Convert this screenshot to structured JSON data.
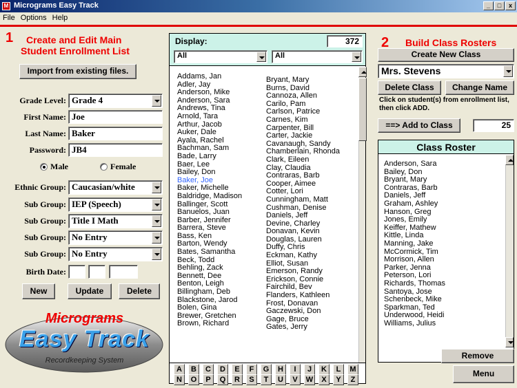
{
  "window": {
    "title": "Micrograms Easy Track",
    "icon": "app-icon",
    "controls": [
      "_",
      "□",
      "x"
    ]
  },
  "menu": [
    "File",
    "Options",
    "Help"
  ],
  "left": {
    "num": "1",
    "heading1": "Create and Edit Main",
    "heading2": "Student Enrollment List",
    "import_button": "Import from existing files.",
    "grade_label": "Grade Level:",
    "grade_value": "Grade 4",
    "first_label": "First Name:",
    "first_value": "Joe",
    "last_label": "Last Name:",
    "last_value": "Baker",
    "password_label": "Password:",
    "password_value": "JB4",
    "male_label": "Male",
    "female_label": "Female",
    "gender_selected": "Male",
    "ethnic_label": "Ethnic Group:",
    "ethnic_value": "Caucasian/white",
    "sub_label": "Sub Group:",
    "sub1": "IEP (Speech)",
    "sub2": "Title I Math",
    "sub3": "No Entry",
    "sub4": "No Entry",
    "birth_label": "Birth Date:",
    "new_button": "New",
    "update_button": "Update",
    "delete_button": "Delete"
  },
  "logo": {
    "line1": "Micrograms",
    "line2": "Easy Track",
    "line3": "Recordkeeping System"
  },
  "display": {
    "label": "Display:",
    "count": "372",
    "filter1": "All",
    "filter2": "All",
    "col1": [
      "Addams, Jan",
      "Adler, Jay",
      "Anderson, Mike",
      "Anderson, Sara",
      "Andrews, Tina",
      "Arnold, Tara",
      "Arthur, Jacob",
      "Auker, Dale",
      "Ayala, Rachel",
      "Bachman, Sam",
      "Bade, Larry",
      "Baer, Lee",
      "Bailey, Don",
      "Baker, Joe",
      "Baker, Michelle",
      "Baldridge, Madison",
      "Ballinger, Scott",
      "Banuelos, Juan",
      "Barber, Jennifer",
      "Barrera, Steve",
      "Bass, Ken",
      "Barton, Wendy",
      "Bates, Samantha",
      "Beck, Todd",
      "Behling, Zack",
      "Bennett, Dee",
      "Benton, Leigh",
      "Billingham, Deb",
      "Blackstone, Jarod",
      "Bolen, Gina",
      "Brewer, Gretchen",
      "Brown, Richard"
    ],
    "col2": [
      "Bryant, Mary",
      "Burns, David",
      "Cannoza, Allen",
      "Carilo, Pam",
      "Carlson, Patrice",
      "Carnes, Kim",
      "Carpenter, Bill",
      "Carter, Jackie",
      "Cavanaugh, Sandy",
      "Chamberlain, Rhonda",
      "Clark, Eileen",
      "Clay, Claudia",
      "Contraras, Barb",
      "Cooper, Aimee",
      "Cotter, Lori",
      "Cunningham, Matt",
      "Cushman, Denise",
      "Daniels, Jeff",
      "Devine, Charley",
      "Donavan, Kevin",
      "Douglas, Lauren",
      "Duffy, Chris",
      "Eckman, Kathy",
      "Elliot, Susan",
      "Emerson, Randy",
      "Erickson, Connie",
      "Fairchild, Bev",
      "Flanders, Kathleen",
      "Frost, Donavan",
      "Gaczewski, Don",
      "Gage, Bruce",
      "Gates, Jerry"
    ],
    "selected": "Baker, Joe",
    "alpha1": [
      "A",
      "B",
      "C",
      "D",
      "E",
      "F",
      "G",
      "H",
      "I",
      "J",
      "K",
      "L",
      "M"
    ],
    "alpha2": [
      "N",
      "O",
      "P",
      "Q",
      "R",
      "S",
      "T",
      "U",
      "V",
      "W",
      "X",
      "Y",
      "Z"
    ]
  },
  "right": {
    "num": "2",
    "heading": "Build Class Rosters",
    "create_button": "Create New Class",
    "class_value": "Mrs. Stevens",
    "delete_class": "Delete Class",
    "change_name": "Change Name",
    "instructions": "Click on student(s) from enrollment list, then click ADD.",
    "add_button": "==> Add to Class",
    "add_count": "25",
    "roster_title": "Class Roster",
    "roster": [
      "Anderson, Sara",
      "Bailey, Don",
      "Bryant, Mary",
      "Contraras, Barb",
      "Daniels, Jeff",
      "Graham, Ashley",
      "Hanson, Greg",
      "Jones, Emily",
      "Keiffer, Mathew",
      "Kittle, Linda",
      "Manning, Jake",
      "McCormick, Tim",
      "Morrison, Allen",
      "Parker, Jenna",
      "Peterson, Lori",
      "Richards, Thomas",
      "Santoya, Jose",
      "Schenbeck, Mike",
      "Sparkman, Ted",
      "Underwood, Heidi",
      "Williams, Julius"
    ],
    "remove_button": "Remove",
    "menu_button": "Menu"
  }
}
